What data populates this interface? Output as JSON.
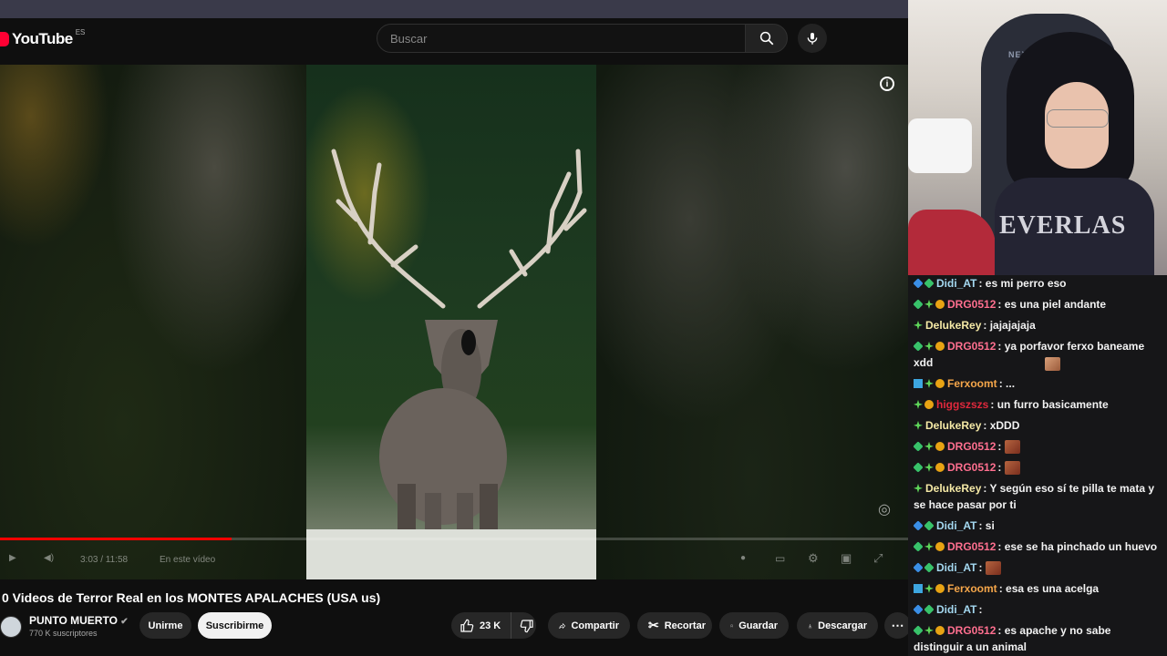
{
  "youtube": {
    "logo_text": "YouTube",
    "country_code": "ES",
    "search_placeholder": "Buscar",
    "player": {
      "time": "3:03 / 11:58",
      "chapter": "En este vídeo",
      "progress": 0.255
    },
    "video_title": "0 Videos de Terror Real en los MONTES APALACHES (USA us)",
    "channel_name": "PUNTO MUERTO",
    "subscribers": "770 K suscriptores",
    "join_label": "Unirme",
    "subscribe_label": "Suscribirme",
    "like_count": "23 K",
    "share_label": "Compartir",
    "clip_label": "Recortar",
    "save_label": "Guardar",
    "download_label": "Descargar"
  },
  "webcam": {
    "chair_logo": "NEXT",
    "shirt_text": "EVERLAS"
  },
  "chat": {
    "messages": [
      {
        "user": "Didi_AT",
        "color": "#a4d8f0",
        "badges": [
          "cube",
          "gem"
        ],
        "text": "es mi perro eso"
      },
      {
        "user": "DRG0512",
        "color": "#ff6f8f",
        "badges": [
          "gem",
          "star",
          "coin"
        ],
        "text": "es una piel andante"
      },
      {
        "user": "DelukeRey",
        "color": "#f5e9a6",
        "badges": [
          "star"
        ],
        "text": "jajajajaja"
      },
      {
        "user": "DRG0512",
        "color": "#ff6f8f",
        "badges": [
          "gem",
          "star",
          "coin"
        ],
        "text": "ya porfavor ferxo baneame xdd"
      },
      {
        "user": "Ferxoomt",
        "color": "#f5a64a",
        "badges": [
          "x",
          "star",
          "coin"
        ],
        "text": "..."
      },
      {
        "user": "higgszszs",
        "color": "#e0283c",
        "badges": [
          "star",
          "coin"
        ],
        "text": "un furro basicamente"
      },
      {
        "user": "DelukeRey",
        "color": "#f5e9a6",
        "badges": [
          "star"
        ],
        "text": "xDDD"
      },
      {
        "user": "DRG0512",
        "color": "#ff6f8f",
        "badges": [
          "gem",
          "star",
          "coin"
        ],
        "text": "",
        "emote": "emote"
      },
      {
        "user": "DRG0512",
        "color": "#ff6f8f",
        "badges": [
          "gem",
          "star",
          "coin"
        ],
        "text": "",
        "emote": "emote"
      },
      {
        "user": "DelukeRey",
        "color": "#f5e9a6",
        "badges": [
          "star"
        ],
        "text": "Y según eso sí te pilla te mata y se hace pasar por ti"
      },
      {
        "user": "Didi_AT",
        "color": "#a4d8f0",
        "badges": [
          "cube",
          "gem"
        ],
        "text": "si"
      },
      {
        "user": "DRG0512",
        "color": "#ff6f8f",
        "badges": [
          "gem",
          "star",
          "coin"
        ],
        "text": "ese se ha pinchado un huevo"
      },
      {
        "user": "Didi_AT",
        "color": "#a4d8f0",
        "badges": [
          "cube",
          "gem"
        ],
        "text": "",
        "emote": "emote"
      },
      {
        "user": "Ferxoomt",
        "color": "#f5a64a",
        "badges": [
          "x",
          "star",
          "coin"
        ],
        "text": "esa es una acelga"
      },
      {
        "user": "Didi_AT",
        "color": "#a4d8f0",
        "badges": [
          "cube",
          "gem"
        ],
        "text": "",
        "emote": "face"
      },
      {
        "user": "DRG0512",
        "color": "#ff6f8f",
        "badges": [
          "gem",
          "star",
          "coin"
        ],
        "text": "es apache y no sabe distinguir a un animal"
      }
    ]
  }
}
